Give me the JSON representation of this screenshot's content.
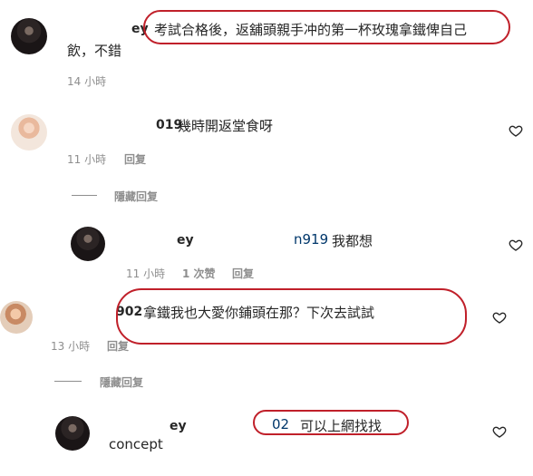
{
  "comments": [
    {
      "username": "ey",
      "text_line1": "考試合格後，返舖頭親手冲的第一杯玫瑰拿鐵俾自己",
      "text_line2": "飲，不錯",
      "time": "14 小時"
    },
    {
      "username": "019",
      "text": "幾時開返堂食呀",
      "time": "11 小時",
      "reply_label": "回复",
      "hide_label": "隱藏回复"
    },
    {
      "username": "ey",
      "mention": "n919",
      "text": "我都想",
      "time": "11 小時",
      "likes": "1 次赞",
      "reply_label": "回复"
    },
    {
      "username": "902",
      "text": "拿鐵我也大愛你鋪頭在那？下次去試試",
      "time": "13 小時",
      "reply_label": "回复",
      "hide_label": "隱藏回复"
    },
    {
      "username": "ey",
      "mention": "02",
      "text": "可以上網找找",
      "overlay_text": "concept"
    }
  ],
  "icons": {
    "like": "heart-icon"
  },
  "colors": {
    "highlight_oval": "#c0202a",
    "mention": "#00376b"
  }
}
